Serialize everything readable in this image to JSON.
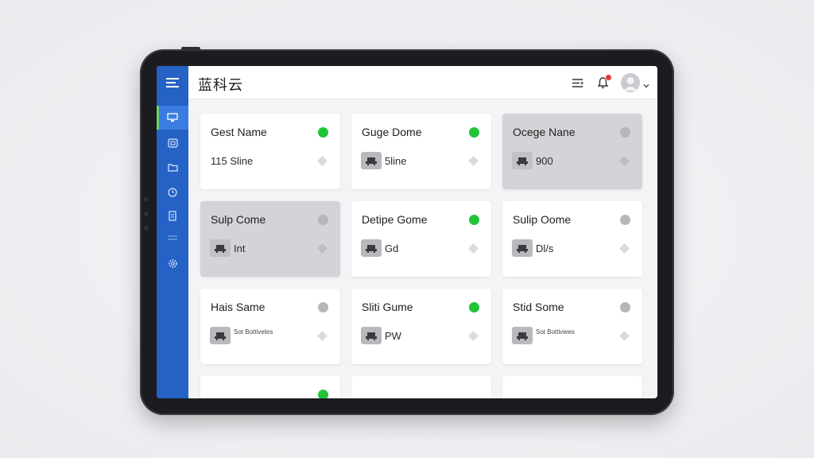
{
  "app": {
    "title": "蓝科云"
  },
  "sidebar": {
    "items": [
      {
        "icon": "monitor-icon"
      },
      {
        "icon": "device-icon"
      },
      {
        "icon": "folder-icon"
      },
      {
        "icon": "clock-icon"
      },
      {
        "icon": "document-icon"
      },
      {
        "icon": "divider-icon"
      },
      {
        "icon": "gear-icon"
      }
    ]
  },
  "header": {
    "icons": [
      "list-icon",
      "bell-icon",
      "avatar",
      "chevron-down-icon"
    ]
  },
  "cards": [
    {
      "name": "Gest Name",
      "value": "115 Sline",
      "status": "online",
      "has_icon": false
    },
    {
      "name": "Guge Dome",
      "value": "5line",
      "status": "online",
      "has_icon": true
    },
    {
      "name": "Ocege Nane",
      "value": "900",
      "status": "offline",
      "has_icon": true
    },
    {
      "name": "Sulp Come",
      "value": "Int",
      "status": "offline",
      "has_icon": true
    },
    {
      "name": "Detipe Gome",
      "value": "Gd",
      "status": "online",
      "has_icon": true
    },
    {
      "name": "Sulip Oome",
      "value": "Dl/s",
      "status": "idle",
      "has_icon": true
    },
    {
      "name": "Hais Same",
      "value": "Sot Bottivetes",
      "status": "idle",
      "has_icon": true
    },
    {
      "name": "Sliti Gume",
      "value": "PW",
      "status": "online",
      "has_icon": true
    },
    {
      "name": "Stid Some",
      "value": "Sot Bottiviees",
      "status": "idle",
      "has_icon": true
    }
  ],
  "colors": {
    "sidebar": "#2462c6",
    "accent_active": "#3a7de0",
    "online": "#21c437",
    "offline": "#b6b7ba",
    "notification": "#e53935"
  }
}
